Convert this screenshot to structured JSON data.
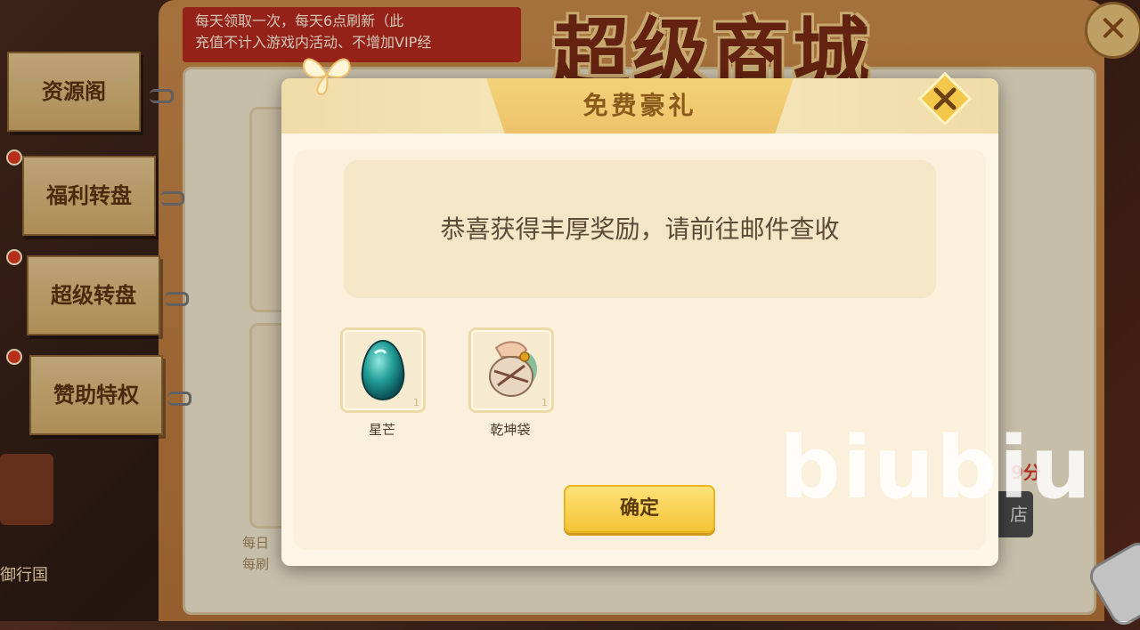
{
  "background": {
    "daily_banner_line1": "每天领取一次，每天6点刷新（此",
    "daily_banner_line2": "充值不计入游戏内活动、不增加VIP经",
    "shop_title": "超级商城",
    "bottom_left_fragment": "御行国",
    "shop_bottom_fragment_1": "每日",
    "shop_bottom_fragment_2": "每刷",
    "right_fragment": "9分",
    "right_button_fragment": "店"
  },
  "side_tabs": [
    {
      "label": "资源阁",
      "has_dot": false
    },
    {
      "label": "福利转盘",
      "has_dot": true
    },
    {
      "label": "超级转盘",
      "has_dot": true
    },
    {
      "label": "赞助特权",
      "has_dot": true
    }
  ],
  "modal": {
    "title": "免费豪礼",
    "message": "恭喜获得丰厚奖励，请前往邮件查收",
    "rewards": [
      {
        "name": "星芒",
        "count": "1",
        "icon": "gem-icon"
      },
      {
        "name": "乾坤袋",
        "count": "1",
        "icon": "pouch-icon"
      }
    ],
    "confirm_label": "确定"
  },
  "watermark": "biubiu",
  "colors": {
    "accent_yellow": "#f5c436",
    "banner_red": "#b52a1e",
    "tab_tan": "#d2ad6b",
    "modal_bg": "#fdf6e6"
  }
}
